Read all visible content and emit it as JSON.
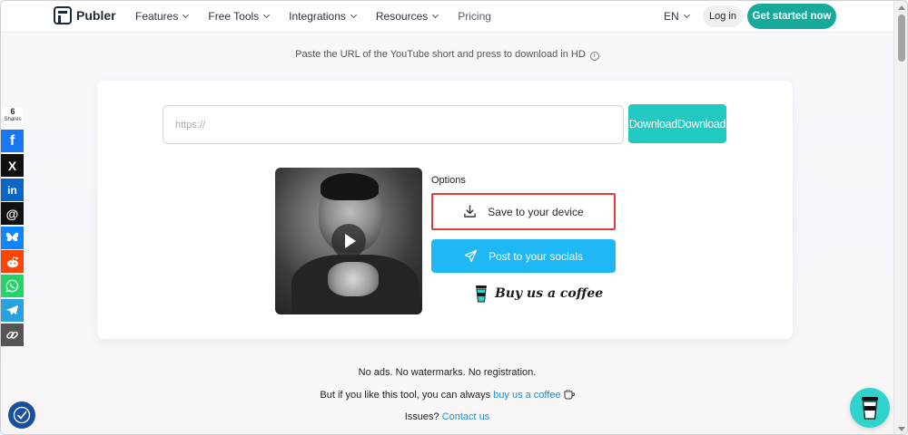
{
  "header": {
    "brand": "Publer",
    "nav": [
      {
        "label": "Features",
        "has_dropdown": true
      },
      {
        "label": "Free Tools",
        "has_dropdown": true
      },
      {
        "label": "Integrations",
        "has_dropdown": true
      },
      {
        "label": "Resources",
        "has_dropdown": true
      },
      {
        "label": "Pricing",
        "has_dropdown": false
      }
    ],
    "language": "EN",
    "login_label": "Log in",
    "cta_label": "Get started now"
  },
  "subtitle": "Paste the URL of the YouTube short and press to download in HD",
  "subtitle_info_glyph": "i",
  "form": {
    "url_placeholder": "https://",
    "url_value": "",
    "download_label": "DownloadDownload"
  },
  "options": {
    "title": "Options",
    "save_label": "Save to your device",
    "post_label": "Post to your socials",
    "coffee_label": "Buy us a coffee"
  },
  "footer": {
    "line1": "No ads. No watermarks. No registration.",
    "line2_prefix": "But if you like this tool, you can always",
    "line2_link": "buy us a coffee",
    "line3_prefix": "Issues?",
    "line3_link": "Contact us"
  },
  "share_bar": {
    "count": "6",
    "label": "Shares",
    "networks": [
      {
        "name": "facebook",
        "glyph": "f",
        "color": "#1877f2"
      },
      {
        "name": "x",
        "glyph": "X",
        "color": "#111111"
      },
      {
        "name": "linkedin",
        "glyph": "in",
        "color": "#0a66c2"
      },
      {
        "name": "threads",
        "glyph": "@",
        "color": "#111111"
      },
      {
        "name": "bluesky",
        "glyph": "",
        "color": "#1185fe"
      },
      {
        "name": "reddit",
        "glyph": "",
        "color": "#ff4500"
      },
      {
        "name": "whatsapp",
        "glyph": "",
        "color": "#25d366"
      },
      {
        "name": "telegram",
        "glyph": "",
        "color": "#2aa3dc"
      },
      {
        "name": "copy-link",
        "glyph": "",
        "color": "#555555"
      }
    ]
  },
  "colors": {
    "cta": "#17a99a",
    "download": "#22c9c0",
    "post": "#1fb8f5",
    "highlight": "#e03b3b",
    "link": "#1d8fd6"
  }
}
